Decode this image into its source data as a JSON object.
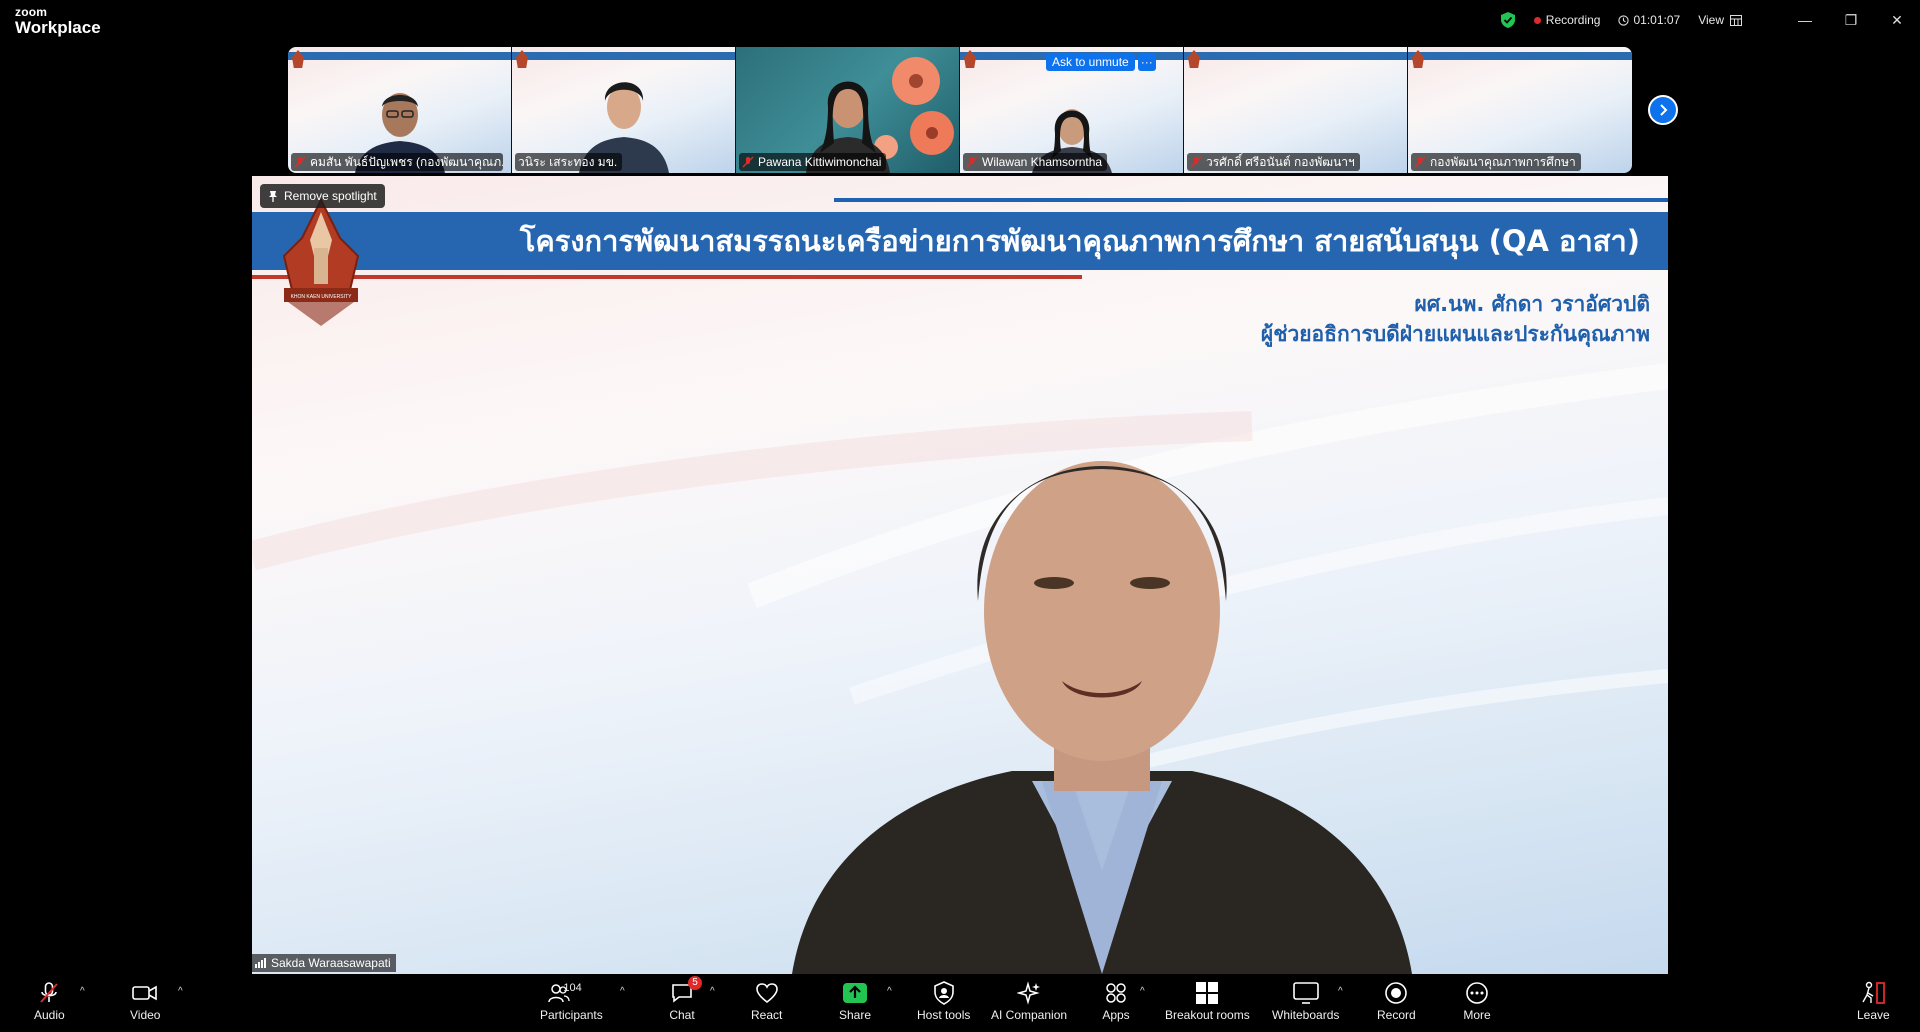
{
  "app": {
    "logo_top": "zoom",
    "logo_bottom": "Workplace"
  },
  "titlebar": {
    "recording_label": "Recording",
    "timer": "01:01:07",
    "view_label": "View",
    "minimize": "—",
    "restore": "❐",
    "close": "✕"
  },
  "gallery": {
    "ask_to_unmute": "Ask to unmute",
    "more": "···",
    "tiles": [
      {
        "name": "คมสัน พันธ์ปัญเพชร (กองพัฒนาคุณภ...",
        "muted": true
      },
      {
        "name": "วนิระ เสระทอง มข.",
        "muted": false
      },
      {
        "name": "Pawana Kittiwimonchai",
        "muted": true
      },
      {
        "name": "Wilawan Khamsorntha",
        "muted": true
      },
      {
        "name": "วรศักดิ์  ศรีอนันต์  กองพัฒนาฯ",
        "muted": true
      },
      {
        "name": "กองพัฒนาคุณภาพการศึกษา",
        "muted": true
      }
    ]
  },
  "stage": {
    "remove_spotlight": "Remove spotlight",
    "speaker_name": "Sakda Waraasawapati",
    "slide": {
      "title": "โครงการพัฒนาสมรรถนะเครือข่ายการพัฒนาคุณภาพการศึกษา สายสนับสนุน (QA อาสา)",
      "presenter": "ผศ.นพ. ศักดา วราอัศวปติ",
      "position": "ผู้ช่วยอธิการบดีฝ่ายแผนและประกันคุณภาพ",
      "seal_text": "KHON KAEN UNIVERSITY"
    }
  },
  "toolbar": {
    "audio": "Audio",
    "video": "Video",
    "participants": "Participants",
    "participants_count": "104",
    "chat": "Chat",
    "chat_badge": "5",
    "react": "React",
    "share": "Share",
    "host_tools": "Host tools",
    "ai_companion": "AI Companion",
    "apps": "Apps",
    "breakout_rooms": "Breakout rooms",
    "whiteboards": "Whiteboards",
    "record": "Record",
    "more": "More",
    "leave": "Leave"
  },
  "colors": {
    "accent": "#0e72ed",
    "share_green": "#23c552",
    "danger": "#e02a2a",
    "slide_blue": "#2666b0"
  }
}
